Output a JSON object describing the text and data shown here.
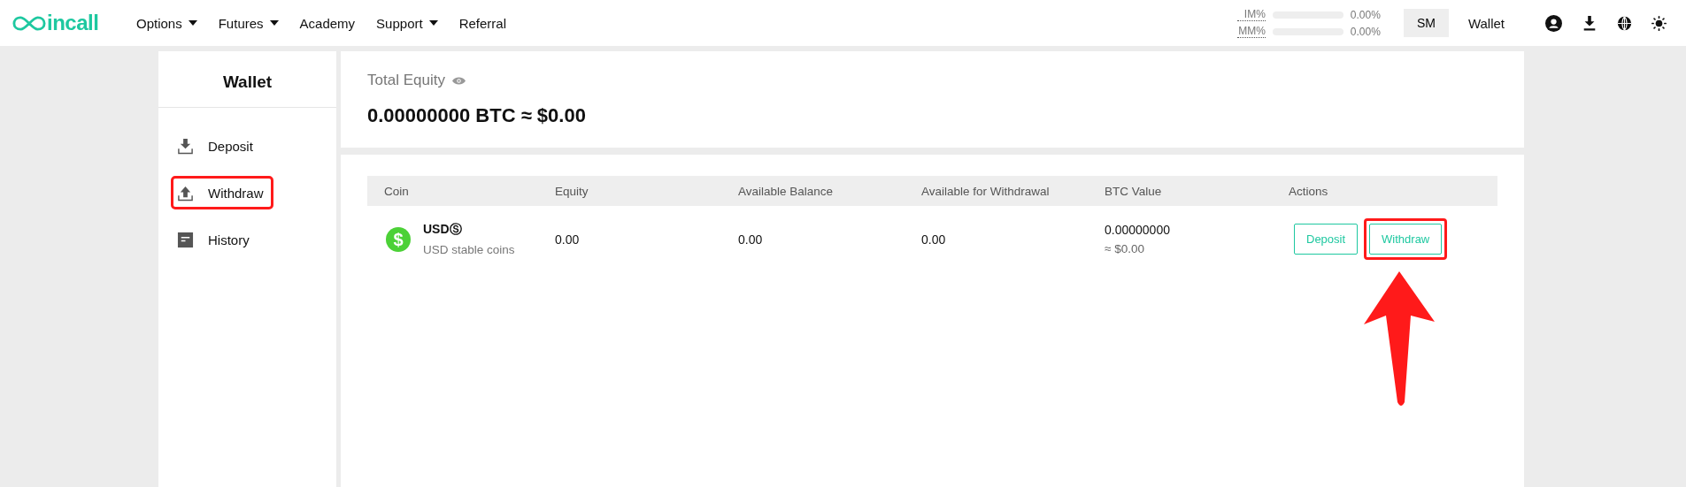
{
  "header": {
    "logo_text": "incall",
    "nav": [
      {
        "label": "Options",
        "has_menu": true
      },
      {
        "label": "Futures",
        "has_menu": true
      },
      {
        "label": "Academy",
        "has_menu": false
      },
      {
        "label": "Support",
        "has_menu": true
      },
      {
        "label": "Referral",
        "has_menu": false
      }
    ],
    "meters": [
      {
        "label": "IM%",
        "level": 0,
        "reading": "0.00%"
      },
      {
        "label": "MM%",
        "level": 0,
        "reading": "0.00%"
      }
    ],
    "mode_button": "SM",
    "wallet_link": "Wallet"
  },
  "sidebar": {
    "title": "Wallet",
    "items": [
      {
        "label": "Deposit",
        "kind": "deposit",
        "highlighted": false
      },
      {
        "label": "Withdraw",
        "kind": "withdraw",
        "highlighted": true
      },
      {
        "label": "History",
        "kind": "history",
        "highlighted": false
      }
    ]
  },
  "equity": {
    "label": "Total Equity",
    "value": "0.00000000 BTC ≈ $0.00"
  },
  "table": {
    "columns": [
      "Coin",
      "Equity",
      "Available Balance",
      "Available for Withdrawal",
      "BTC Value",
      "Actions"
    ],
    "rows": [
      {
        "icon_glyph": "$",
        "coin": "USDⓈ",
        "coin_desc": "USD stable coins",
        "equity": "0.00",
        "available_balance": "0.00",
        "available_for_withdrawal": "0.00",
        "btc_value": "0.00000000",
        "usd_value": "≈ $0.00",
        "actions": [
          {
            "label": "Deposit",
            "highlighted": false
          },
          {
            "label": "Withdraw",
            "highlighted": true
          }
        ]
      }
    ]
  },
  "annotation_arrow": true
}
